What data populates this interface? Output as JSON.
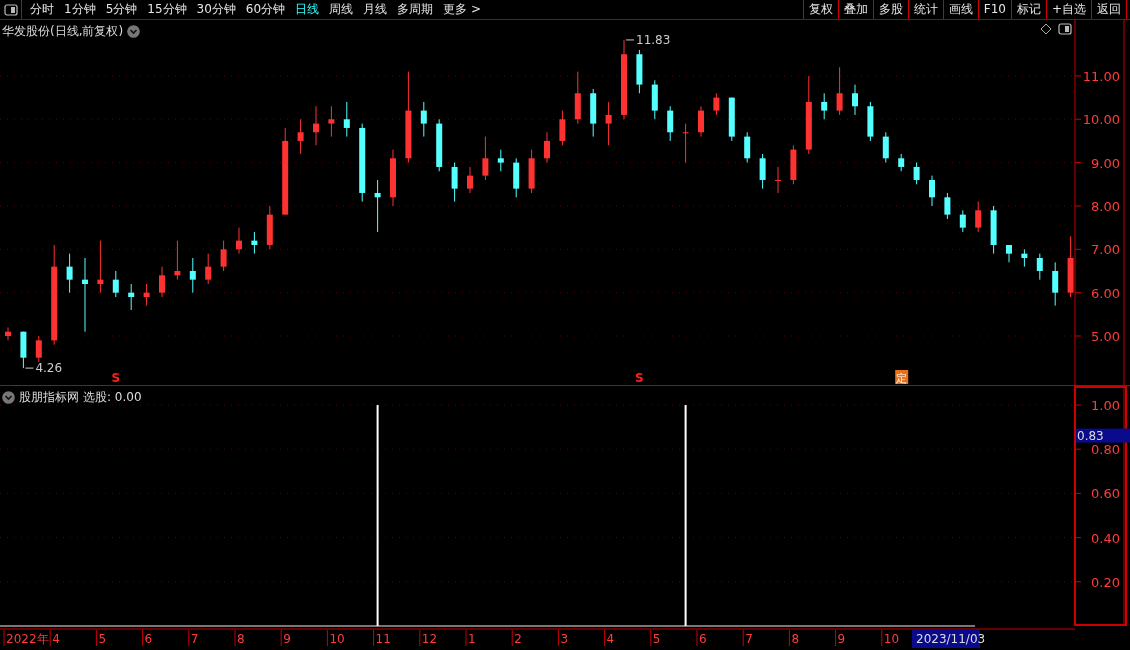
{
  "toolbar": {
    "periods": [
      {
        "label": "分时",
        "selected": false
      },
      {
        "label": "1分钟",
        "selected": false
      },
      {
        "label": "5分钟",
        "selected": false
      },
      {
        "label": "15分钟",
        "selected": false
      },
      {
        "label": "30分钟",
        "selected": false
      },
      {
        "label": "60分钟",
        "selected": false
      },
      {
        "label": "日线",
        "selected": true
      },
      {
        "label": "周线",
        "selected": false
      },
      {
        "label": "月线",
        "selected": false
      },
      {
        "label": "多周期",
        "selected": false
      },
      {
        "label": "更多 >",
        "selected": false
      }
    ],
    "buttons": [
      "复权",
      "叠加",
      "多股",
      "统计",
      "画线",
      "F10",
      "标记",
      "+自选",
      "返回"
    ]
  },
  "price_panel": {
    "title": "华发股份(日线,前复权)",
    "chart_data": {
      "type": "candlestick",
      "ylim": [
        3.87,
        12.29
      ],
      "grid": true,
      "yticks": [
        {
          "value": 5,
          "label": "5.00"
        },
        {
          "value": 6,
          "label": "6.00"
        },
        {
          "value": 7,
          "label": "7.00"
        },
        {
          "value": 8,
          "label": "8.00"
        },
        {
          "value": 9,
          "label": "9.00"
        },
        {
          "value": 10,
          "label": "10.00"
        },
        {
          "value": 11,
          "label": "11.00"
        }
      ],
      "categories": [
        null,
        null,
        null,
        null,
        null,
        null,
        null,
        "S",
        null,
        null,
        null,
        null,
        null,
        null,
        null,
        null,
        null,
        null,
        null,
        null,
        null,
        null,
        null,
        null,
        null,
        null,
        null,
        null,
        null,
        null,
        null,
        null,
        null,
        null,
        null,
        null,
        null,
        null,
        null,
        null,
        null,
        "S",
        null,
        null,
        null,
        null,
        null,
        null,
        null,
        null,
        null,
        null,
        null,
        null,
        null,
        null,
        null,
        null,
        "定",
        null,
        null,
        null,
        null,
        null,
        null,
        null,
        null,
        null,
        null,
        null
      ],
      "ohlc": [
        [
          5.0,
          5.2,
          4.9,
          5.1
        ],
        [
          5.1,
          5.1,
          4.26,
          4.5
        ],
        [
          4.5,
          5.0,
          4.4,
          4.9
        ],
        [
          4.9,
          7.1,
          4.8,
          6.6
        ],
        [
          6.6,
          6.9,
          6.0,
          6.3
        ],
        [
          6.3,
          6.8,
          5.1,
          6.2
        ],
        [
          6.2,
          7.2,
          6.0,
          6.3
        ],
        [
          6.3,
          6.5,
          5.9,
          6.0
        ],
        [
          6.0,
          6.2,
          5.6,
          5.9
        ],
        [
          5.9,
          6.2,
          5.7,
          6.0
        ],
        [
          6.0,
          6.6,
          5.9,
          6.4
        ],
        [
          6.4,
          7.2,
          6.3,
          6.5
        ],
        [
          6.5,
          6.8,
          6.0,
          6.3
        ],
        [
          6.3,
          6.9,
          6.2,
          6.6
        ],
        [
          6.6,
          7.2,
          6.5,
          7.0
        ],
        [
          7.0,
          7.5,
          6.9,
          7.2
        ],
        [
          7.2,
          7.4,
          6.9,
          7.1
        ],
        [
          7.1,
          8.0,
          7.0,
          7.8
        ],
        [
          7.8,
          9.8,
          7.8,
          9.5
        ],
        [
          9.5,
          10.0,
          9.2,
          9.7
        ],
        [
          9.7,
          10.3,
          9.4,
          9.9
        ],
        [
          9.9,
          10.3,
          9.6,
          10.0
        ],
        [
          10.0,
          10.4,
          9.6,
          9.8
        ],
        [
          9.8,
          9.9,
          8.1,
          8.3
        ],
        [
          8.3,
          8.6,
          7.4,
          8.2
        ],
        [
          8.2,
          9.3,
          8.0,
          9.1
        ],
        [
          9.1,
          11.1,
          9.0,
          10.2
        ],
        [
          10.2,
          10.4,
          9.6,
          9.9
        ],
        [
          9.9,
          10.0,
          8.8,
          8.9
        ],
        [
          8.9,
          9.0,
          8.1,
          8.4
        ],
        [
          8.4,
          8.9,
          8.3,
          8.7
        ],
        [
          8.7,
          9.6,
          8.6,
          9.1
        ],
        [
          9.1,
          9.3,
          8.8,
          9.0
        ],
        [
          9.0,
          9.1,
          8.2,
          8.4
        ],
        [
          8.4,
          9.3,
          8.3,
          9.1
        ],
        [
          9.1,
          9.7,
          9.0,
          9.5
        ],
        [
          9.5,
          10.2,
          9.4,
          10.0
        ],
        [
          10.0,
          11.1,
          9.9,
          10.6
        ],
        [
          10.6,
          10.7,
          9.6,
          9.9
        ],
        [
          9.9,
          10.4,
          9.4,
          10.1
        ],
        [
          10.1,
          11.83,
          10.0,
          11.5
        ],
        [
          11.5,
          11.6,
          10.6,
          10.8
        ],
        [
          10.8,
          10.9,
          10.0,
          10.2
        ],
        [
          10.2,
          10.3,
          9.5,
          9.7
        ],
        [
          9.7,
          9.9,
          9.0,
          9.7
        ],
        [
          9.7,
          10.3,
          9.6,
          10.2
        ],
        [
          10.2,
          10.6,
          10.1,
          10.5
        ],
        [
          10.5,
          10.5,
          9.5,
          9.6
        ],
        [
          9.6,
          9.7,
          9.0,
          9.1
        ],
        [
          9.1,
          9.2,
          8.4,
          8.6
        ],
        [
          8.6,
          8.9,
          8.3,
          8.6
        ],
        [
          8.6,
          9.4,
          8.5,
          9.3
        ],
        [
          9.3,
          11.0,
          9.2,
          10.4
        ],
        [
          10.4,
          10.6,
          10.0,
          10.2
        ],
        [
          10.2,
          11.2,
          10.1,
          10.6
        ],
        [
          10.6,
          10.8,
          10.1,
          10.3
        ],
        [
          10.3,
          10.4,
          9.5,
          9.6
        ],
        [
          9.6,
          9.7,
          9.0,
          9.1
        ],
        [
          9.1,
          9.2,
          8.8,
          8.9
        ],
        [
          8.9,
          9.0,
          8.5,
          8.6
        ],
        [
          8.6,
          8.7,
          8.0,
          8.2
        ],
        [
          8.2,
          8.3,
          7.7,
          7.8
        ],
        [
          7.8,
          7.9,
          7.4,
          7.5
        ],
        [
          7.5,
          8.1,
          7.4,
          7.9
        ],
        [
          7.9,
          8.0,
          6.9,
          7.1
        ],
        [
          7.1,
          7.1,
          6.7,
          6.9
        ],
        [
          6.9,
          7.0,
          6.6,
          6.8
        ],
        [
          6.8,
          6.9,
          6.3,
          6.5
        ],
        [
          6.5,
          6.7,
          5.7,
          6.0
        ],
        [
          6.0,
          7.3,
          5.9,
          6.8
        ]
      ],
      "annotations": [
        "11.83",
        "4.26"
      ]
    }
  },
  "indicator_panel": {
    "name": "股朋指标网",
    "reading": "选股: 0.00",
    "cursor_value": "0.83",
    "cursor_date": "2023/11/03",
    "chart_data": {
      "type": "bar",
      "ylim": [
        0,
        1.086
      ],
      "grid": true,
      "yticks": [
        {
          "value": 0.2,
          "label": "0.20"
        },
        {
          "value": 0.4,
          "label": "0.40"
        },
        {
          "value": 0.6,
          "label": "0.60"
        },
        {
          "value": 0.8,
          "label": "0.80"
        },
        {
          "value": 1,
          "label": "1.00"
        }
      ],
      "categories": [
        "2022年",
        null,
        null,
        "4",
        null,
        null,
        "5",
        null,
        null,
        "6",
        null,
        null,
        "7",
        null,
        null,
        "8",
        null,
        null,
        "9",
        null,
        null,
        "10",
        null,
        null,
        "11",
        null,
        null,
        "12",
        null,
        null,
        "1",
        null,
        null,
        "2",
        null,
        null,
        "3",
        null,
        null,
        "4",
        null,
        null,
        "5",
        null,
        null,
        "6",
        null,
        null,
        "7",
        null,
        null,
        "8",
        null,
        null,
        "9",
        null,
        null,
        "10",
        null,
        null,
        null,
        null,
        null,
        null,
        null,
        null,
        null,
        null,
        null,
        null
      ],
      "series": [
        {
          "color": "#ffffff",
          "values": [
            0,
            0,
            0,
            0,
            0,
            0,
            0,
            0,
            0,
            0,
            0,
            0,
            0,
            0,
            0,
            0,
            0,
            0,
            0,
            0,
            0,
            0,
            0,
            0,
            1,
            0,
            0,
            0,
            0,
            0,
            0,
            0,
            0,
            0,
            0,
            0,
            0,
            0,
            0,
            0,
            0,
            0,
            0,
            0,
            1,
            0,
            0,
            0,
            0,
            0,
            0,
            0,
            0,
            0,
            0,
            0,
            0,
            0,
            0,
            0,
            0,
            0,
            0,
            0,
            0,
            0,
            0,
            0,
            0,
            0
          ]
        }
      ]
    }
  }
}
